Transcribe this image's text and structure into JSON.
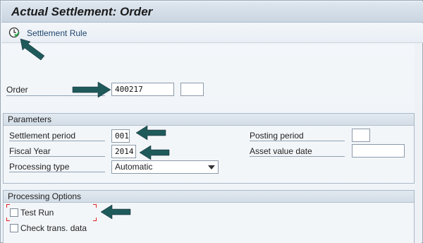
{
  "window": {
    "title": "Actual Settlement: Order"
  },
  "toolbar": {
    "settlement_rule_label": "Settlement Rule",
    "settlement_rule_icon": "settlement-rule-icon"
  },
  "order": {
    "label": "Order",
    "value": "400217",
    "secondary_value": ""
  },
  "parameters": {
    "header": "Parameters",
    "settlement_period": {
      "label": "Settlement period",
      "value": "001"
    },
    "fiscal_year": {
      "label": "Fiscal Year",
      "value": "2014"
    },
    "processing_type": {
      "label": "Processing type",
      "selected": "Automatic"
    },
    "posting_period": {
      "label": "Posting period",
      "value": ""
    },
    "asset_value_date": {
      "label": "Asset value date",
      "value": ""
    }
  },
  "processing_options": {
    "header": "Processing Options",
    "test_run": {
      "label": "Test Run",
      "checked": false
    },
    "check_trans_data": {
      "label": "Check trans. data",
      "checked": false
    }
  },
  "colors": {
    "arrow": "#1f5a5a",
    "focus_marker": "#dd2222",
    "toolbar_text": "#21476f"
  }
}
